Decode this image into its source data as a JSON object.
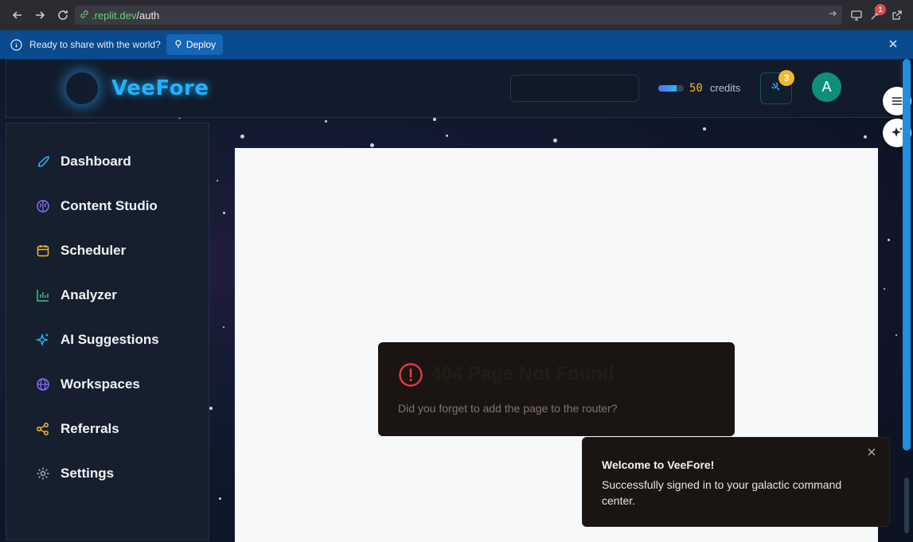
{
  "browser": {
    "url_domain": ".replit.dev",
    "url_path": "/auth",
    "extension_badge": "1"
  },
  "banner": {
    "text": "Ready to share with the world?",
    "deploy_label": "Deploy"
  },
  "header": {
    "brand": "VeeFore",
    "credits_value": "50",
    "credits_label": "credits",
    "credits_fill_fraction": 0.72,
    "notification_count": "3",
    "avatar_initial": "A"
  },
  "sidebar": {
    "items": [
      {
        "label": "Dashboard",
        "icon": "rocket-icon",
        "color": "#2fb4ff"
      },
      {
        "label": "Content Studio",
        "icon": "brain-icon",
        "color": "#8b6cff"
      },
      {
        "label": "Scheduler",
        "icon": "calendar-icon",
        "color": "#f5b72b"
      },
      {
        "label": "Analyzer",
        "icon": "bar-chart-icon",
        "color": "#34c785"
      },
      {
        "label": "AI Suggestions",
        "icon": "sparkles-icon",
        "color": "#2fb4ff"
      },
      {
        "label": "Workspaces",
        "icon": "globe-icon",
        "color": "#8b6cff"
      },
      {
        "label": "Referrals",
        "icon": "share-icon",
        "color": "#f5b72b"
      },
      {
        "label": "Settings",
        "icon": "gear-icon",
        "color": "#aab4c2"
      }
    ]
  },
  "error": {
    "title": "404 Page Not Found",
    "description": "Did you forget to add the page to the router?",
    "icon_color": "#e23c3c"
  },
  "toast": {
    "title": "Welcome to VeeFore!",
    "body": "Successfully signed in to your galactic command center."
  }
}
